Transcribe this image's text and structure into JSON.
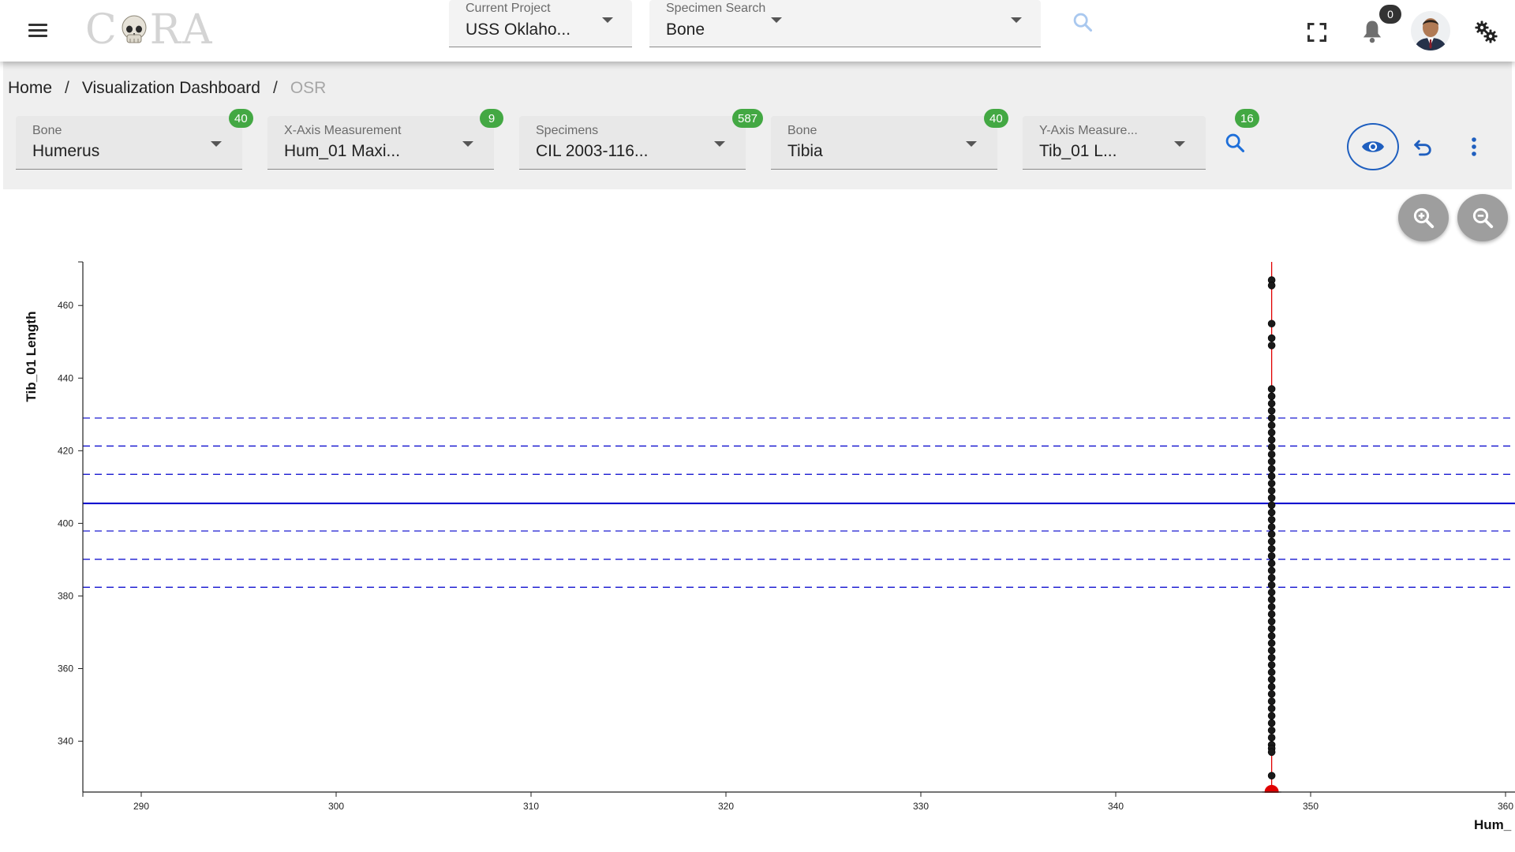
{
  "topbar": {
    "logo_text": "CORA",
    "current_project": {
      "label": "Current Project",
      "value": "USS Oklaho..."
    },
    "specimen_search": {
      "label": "Specimen Search",
      "value": "Bone"
    },
    "notification_count": "0",
    "icons": [
      "menu-icon",
      "search-icon",
      "fullscreen-icon",
      "bell-icon",
      "settings-gears-icon"
    ]
  },
  "breadcrumb": {
    "home": "Home",
    "separator": "/",
    "dashboard": "Visualization Dashboard",
    "current": "OSR"
  },
  "filters": [
    {
      "label": "Bone",
      "value": "Humerus",
      "count": "40"
    },
    {
      "label": "X-Axis Measurement",
      "value": "Hum_01 Maxi...",
      "count": "9"
    },
    {
      "label": "Specimens",
      "value": "CIL 2003-116...",
      "count": "587"
    },
    {
      "label": "Bone",
      "value": "Tibia",
      "count": "40"
    },
    {
      "label": "Y-Axis Measure...",
      "value": "Tib_01 L...",
      "count": "16"
    }
  ],
  "actions": {
    "icons": [
      "search-icon",
      "eye-icon",
      "undo-icon",
      "more-vert-icon",
      "zoom-in-icon",
      "zoom-out-icon"
    ]
  },
  "colors": {
    "accent": "#1f5fbf",
    "badge": "#43a843",
    "regression": "#0000cc",
    "highlight": "#e00000",
    "points": "#1a1a1a"
  },
  "chart_data": {
    "type": "scatter",
    "ylabel": "Tib_01 Length",
    "xlabel": "Hum_",
    "xlim": [
      287,
      360
    ],
    "ylim": [
      326,
      472
    ],
    "x_ticks": [
      290,
      300,
      310,
      320,
      330,
      340,
      350,
      360
    ],
    "y_ticks": [
      340,
      360,
      380,
      400,
      420,
      440,
      460
    ],
    "regression_line_y": 405.5,
    "interval_lines_y": [
      429,
      421.3,
      413.5,
      397.9,
      390.1,
      382.4
    ],
    "selected_x": 348,
    "selected_point": {
      "x": 348,
      "y": 326
    },
    "points": [
      {
        "x": 348,
        "y": 467
      },
      {
        "x": 348,
        "y": 465.5
      },
      {
        "x": 348,
        "y": 455
      },
      {
        "x": 348,
        "y": 451
      },
      {
        "x": 348,
        "y": 449
      },
      {
        "x": 348,
        "y": 437
      },
      {
        "x": 348,
        "y": 435
      },
      {
        "x": 348,
        "y": 433
      },
      {
        "x": 348,
        "y": 431
      },
      {
        "x": 348,
        "y": 429
      },
      {
        "x": 348,
        "y": 427
      },
      {
        "x": 348,
        "y": 425
      },
      {
        "x": 348,
        "y": 423
      },
      {
        "x": 348,
        "y": 421
      },
      {
        "x": 348,
        "y": 419
      },
      {
        "x": 348,
        "y": 417
      },
      {
        "x": 348,
        "y": 415
      },
      {
        "x": 348,
        "y": 413
      },
      {
        "x": 348,
        "y": 411
      },
      {
        "x": 348,
        "y": 409
      },
      {
        "x": 348,
        "y": 407
      },
      {
        "x": 348,
        "y": 405
      },
      {
        "x": 348,
        "y": 403
      },
      {
        "x": 348,
        "y": 401
      },
      {
        "x": 348,
        "y": 399
      },
      {
        "x": 348,
        "y": 397
      },
      {
        "x": 348,
        "y": 395
      },
      {
        "x": 348,
        "y": 393
      },
      {
        "x": 348,
        "y": 391
      },
      {
        "x": 348,
        "y": 389
      },
      {
        "x": 348,
        "y": 387
      },
      {
        "x": 348,
        "y": 385
      },
      {
        "x": 348,
        "y": 383
      },
      {
        "x": 348,
        "y": 381
      },
      {
        "x": 348,
        "y": 379
      },
      {
        "x": 348,
        "y": 377
      },
      {
        "x": 348,
        "y": 375
      },
      {
        "x": 348,
        "y": 373
      },
      {
        "x": 348,
        "y": 371
      },
      {
        "x": 348,
        "y": 369
      },
      {
        "x": 348,
        "y": 367
      },
      {
        "x": 348,
        "y": 365
      },
      {
        "x": 348,
        "y": 363
      },
      {
        "x": 348,
        "y": 361
      },
      {
        "x": 348,
        "y": 359
      },
      {
        "x": 348,
        "y": 357
      },
      {
        "x": 348,
        "y": 355
      },
      {
        "x": 348,
        "y": 353
      },
      {
        "x": 348,
        "y": 351
      },
      {
        "x": 348,
        "y": 349
      },
      {
        "x": 348,
        "y": 347
      },
      {
        "x": 348,
        "y": 345
      },
      {
        "x": 348,
        "y": 343
      },
      {
        "x": 348,
        "y": 341
      },
      {
        "x": 348,
        "y": 339
      },
      {
        "x": 348,
        "y": 338
      },
      {
        "x": 348,
        "y": 337
      },
      {
        "x": 348,
        "y": 330.5
      }
    ]
  }
}
